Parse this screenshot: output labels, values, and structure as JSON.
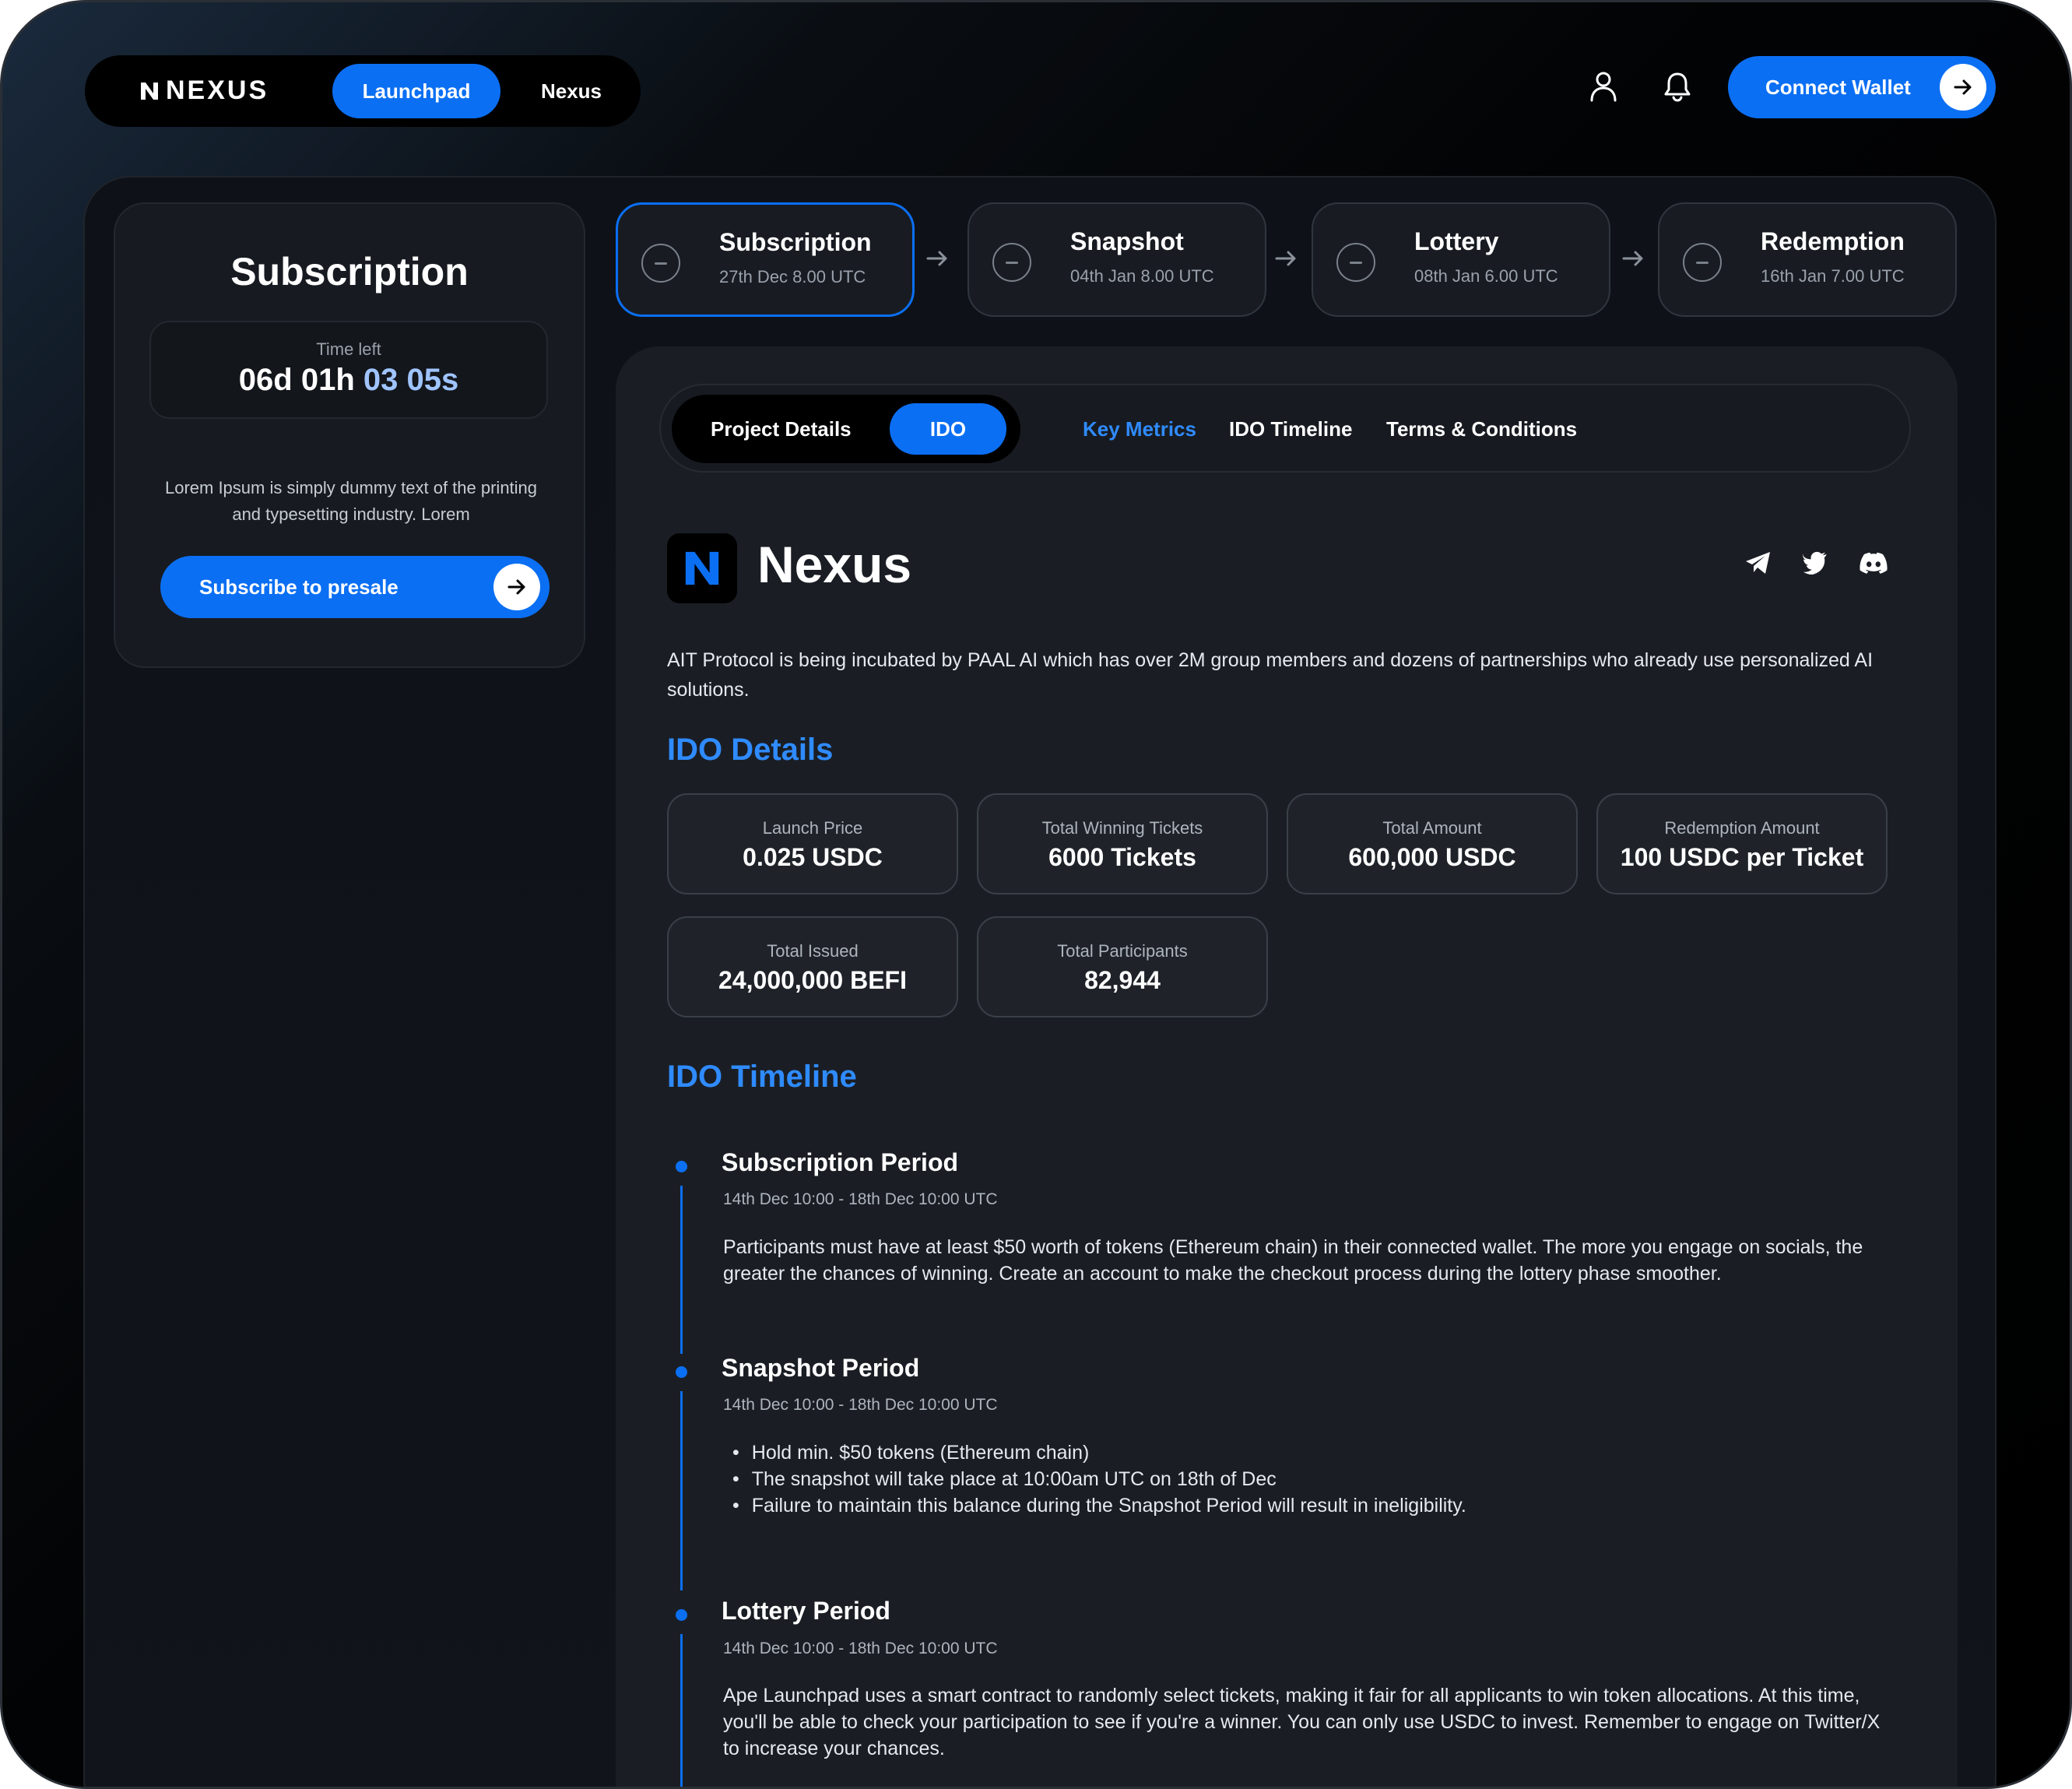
{
  "nav": {
    "logo_text": "NEXUS",
    "items": [
      {
        "label": "Launchpad",
        "active": true
      },
      {
        "label": "Nexus",
        "active": false
      }
    ],
    "connect_label": "Connect Wallet"
  },
  "subscription_card": {
    "title": "Subscription",
    "time_left_label": "Time left",
    "time_main": "06d 01h ",
    "time_dim": "03 05s",
    "description": "Lorem Ipsum is simply dummy text of the printing and typesetting industry. Lorem",
    "button_label": "Subscribe to presale"
  },
  "steps": [
    {
      "title": "Subscription",
      "date": "27th Dec 8.00 UTC",
      "active": true
    },
    {
      "title": "Snapshot",
      "date": "04th Jan 8.00 UTC",
      "active": false
    },
    {
      "title": "Lottery",
      "date": "08th Jan 6.00 UTC",
      "active": false
    },
    {
      "title": "Redemption",
      "date": "16th Jan 7.00 UTC",
      "active": false
    }
  ],
  "tabs": {
    "project_details": "Project Details",
    "ido": "IDO",
    "key_metrics": "Key Metrics",
    "ido_timeline": "IDO Timeline",
    "terms": "Terms & Conditions"
  },
  "project": {
    "name": "Nexus",
    "description": "AIT Protocol is being incubated by PAAL AI which has over 2M group members and dozens of partnerships who already use personalized AI solutions.",
    "socials": [
      "telegram-icon",
      "twitter-icon",
      "discord-icon"
    ]
  },
  "ido_details": {
    "title": "IDO Details",
    "metrics": [
      {
        "label": "Launch Price",
        "value": "0.025 USDC"
      },
      {
        "label": "Total Winning Tickets",
        "value": "6000 Tickets"
      },
      {
        "label": "Total Amount",
        "value": "600,000 USDC"
      },
      {
        "label": "Redemption Amount",
        "value": "100 USDC per Ticket"
      },
      {
        "label": "Total Issued",
        "value": "24,000,000 BEFI"
      },
      {
        "label": "Total Participants",
        "value": "82,944"
      }
    ]
  },
  "ido_timeline": {
    "title": "IDO Timeline",
    "periods": [
      {
        "title": "Subscription Period",
        "date": "14th Dec 10:00 - 18th Dec 10:00 UTC",
        "body": "Participants must have at least $50 worth of tokens (Ethereum chain) in their connected wallet. The more you engage on socials, the greater the chances of winning. Create an account to make the checkout process during the lottery phase smoother."
      },
      {
        "title": "Snapshot Period",
        "date": "14th Dec 10:00 - 18th Dec 10:00 UTC",
        "bullets": [
          "Hold min. $50 tokens (Ethereum chain)",
          "The snapshot will take place at 10:00am UTC on 18th of Dec",
          "Failure to maintain this balance during the Snapshot Period will result in ineligibility."
        ]
      },
      {
        "title": "Lottery Period",
        "date": "14th Dec 10:00 - 18th Dec 10:00 UTC",
        "body": "Ape Launchpad uses a smart contract to randomly select tickets, making it fair for all applicants to win token allocations. At this time, you'll be able to check your participation to see if you're a winner. You can only use USDC to invest. Remember to engage on Twitter/X to increase your chances."
      }
    ]
  },
  "colors": {
    "accent": "#0b6ff3",
    "accent_text": "#2f8bff",
    "panel": "#1a1e24",
    "background": "#000000"
  }
}
